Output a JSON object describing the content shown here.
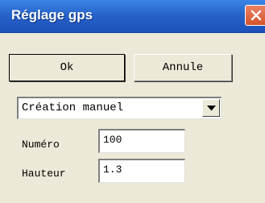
{
  "window": {
    "title": "Réglage gps",
    "close_icon": "close-icon"
  },
  "buttons": {
    "ok_label": "Ok",
    "annule_label": "Annule"
  },
  "mode_select": {
    "selected": "Création manuel",
    "arrow_icon": "chevron-down-icon"
  },
  "fields": {
    "numero": {
      "label": "Numéro",
      "value": "100"
    },
    "hauteur": {
      "label": "Hauteur",
      "value": "1.3"
    }
  },
  "colors": {
    "titlebar": "#2763c9",
    "close_button": "#d4542b",
    "window_bg": "#ece9d8"
  }
}
